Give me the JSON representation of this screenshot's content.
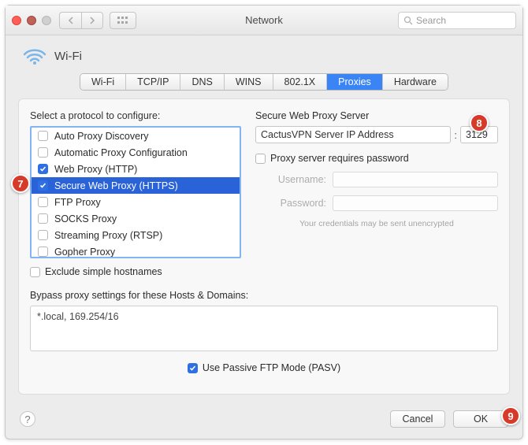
{
  "window": {
    "title": "Network"
  },
  "search": {
    "placeholder": "Search"
  },
  "service": {
    "name": "Wi-Fi"
  },
  "tabs": [
    {
      "label": "Wi-Fi"
    },
    {
      "label": "TCP/IP"
    },
    {
      "label": "DNS"
    },
    {
      "label": "WINS"
    },
    {
      "label": "802.1X"
    },
    {
      "label": "Proxies",
      "active": true
    },
    {
      "label": "Hardware"
    }
  ],
  "left": {
    "heading": "Select a protocol to configure:",
    "exclude_label": "Exclude simple hostnames",
    "exclude_checked": false,
    "protocols": [
      {
        "label": "Auto Proxy Discovery",
        "checked": false,
        "selected": false
      },
      {
        "label": "Automatic Proxy Configuration",
        "checked": false,
        "selected": false
      },
      {
        "label": "Web Proxy (HTTP)",
        "checked": true,
        "selected": false
      },
      {
        "label": "Secure Web Proxy (HTTPS)",
        "checked": true,
        "selected": true
      },
      {
        "label": "FTP Proxy",
        "checked": false,
        "selected": false
      },
      {
        "label": "SOCKS Proxy",
        "checked": false,
        "selected": false
      },
      {
        "label": "Streaming Proxy (RTSP)",
        "checked": false,
        "selected": false
      },
      {
        "label": "Gopher Proxy",
        "checked": false,
        "selected": false
      }
    ]
  },
  "right": {
    "heading": "Secure Web Proxy Server",
    "server_value": "CactusVPN Server IP Address",
    "port_value": "3129",
    "requires_password_label": "Proxy server requires password",
    "requires_password_checked": false,
    "username_label": "Username:",
    "password_label": "Password:",
    "note": "Your credentials may be sent unencrypted"
  },
  "bypass": {
    "label": "Bypass proxy settings for these Hosts & Domains:",
    "value": "*.local, 169.254/16"
  },
  "pasv": {
    "label": "Use Passive FTP Mode (PASV)",
    "checked": true
  },
  "footer": {
    "cancel": "Cancel",
    "ok": "OK"
  },
  "callouts": {
    "c7": "7",
    "c8": "8",
    "c9": "9"
  }
}
